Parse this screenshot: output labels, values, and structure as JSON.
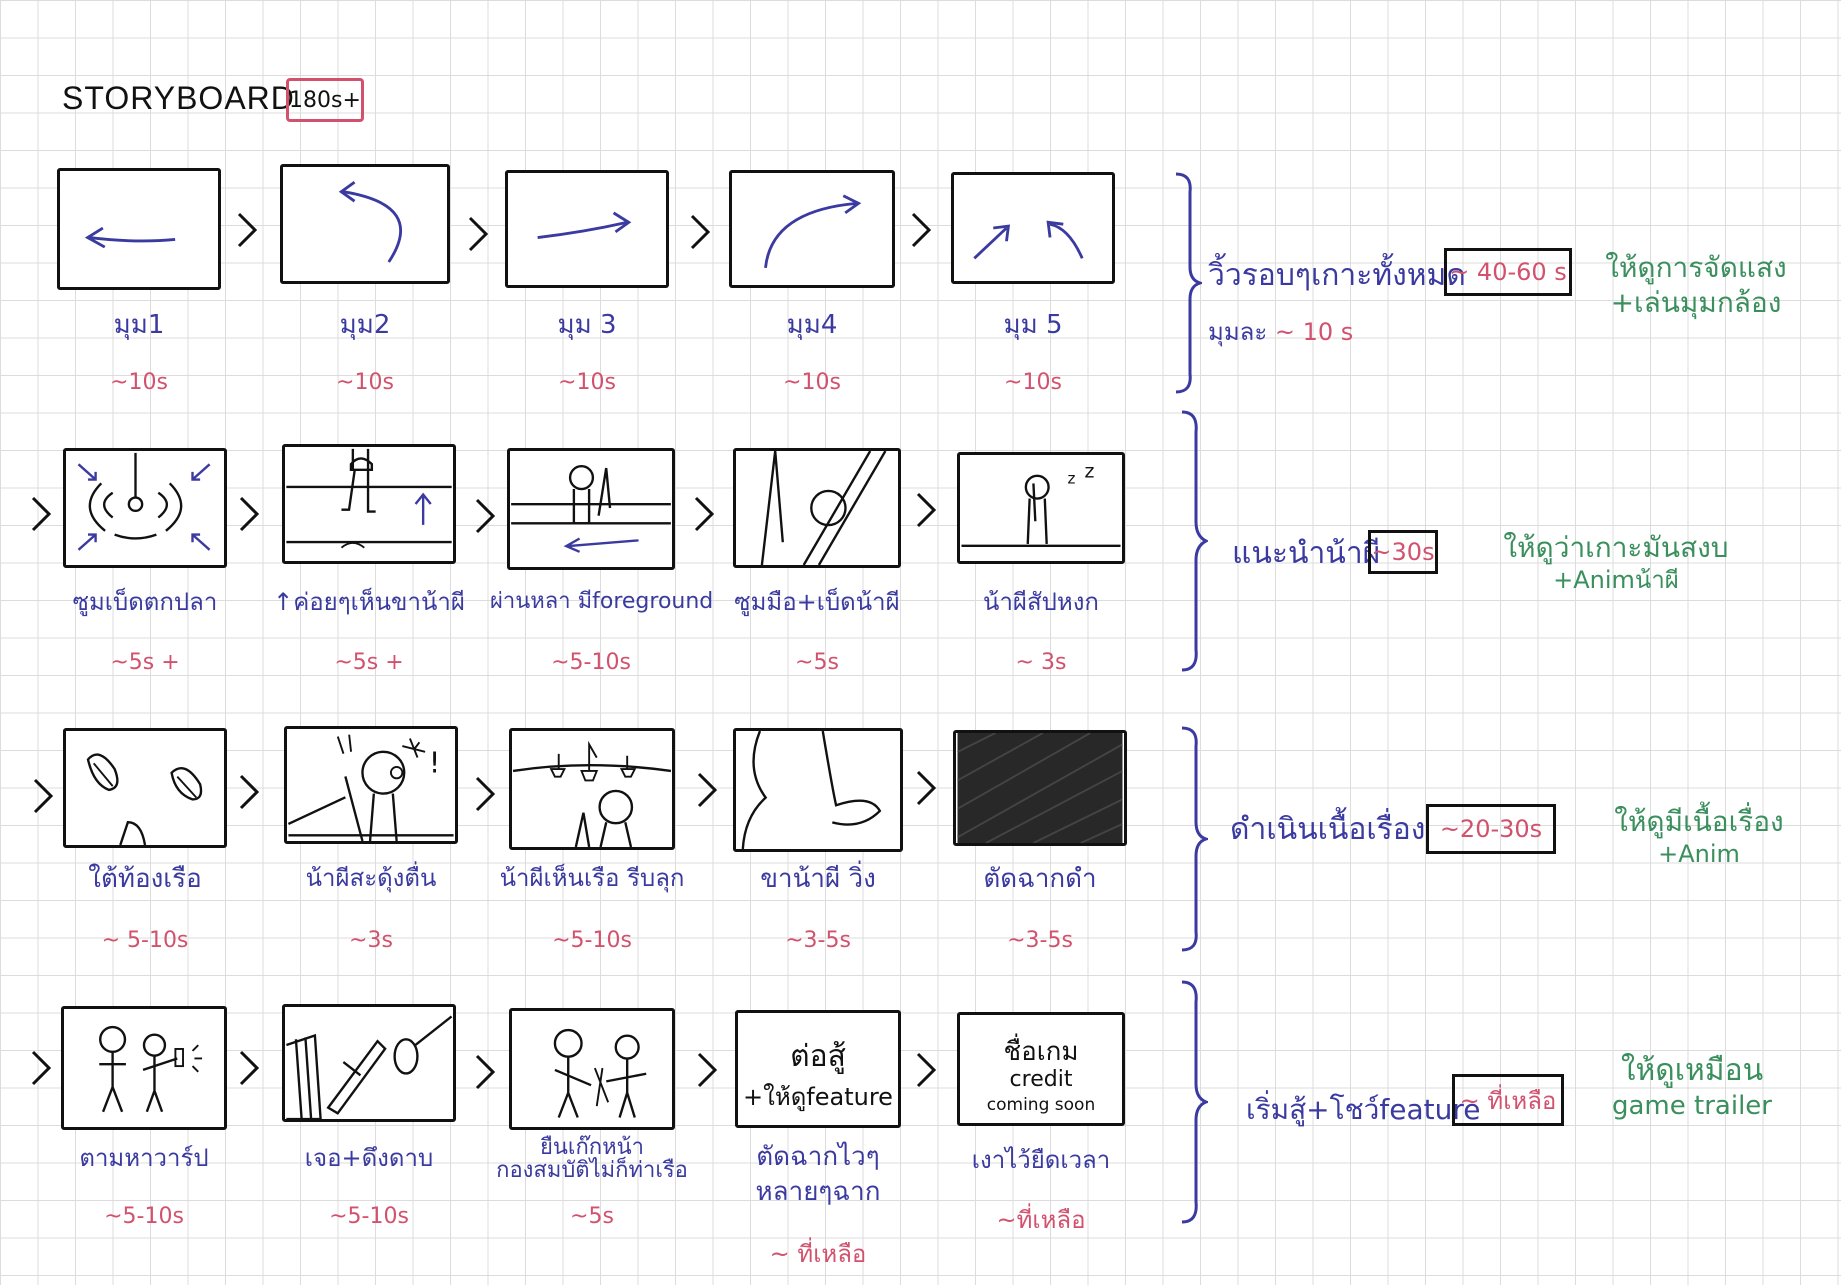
{
  "title": "STORYBOARD",
  "total_badge": "180s+",
  "rows": [
    {
      "shots": [
        {
          "label": "มุม1",
          "duration": "~10s"
        },
        {
          "label": "มุม2",
          "duration": "~10s"
        },
        {
          "label": "มุม 3",
          "duration": "~10s"
        },
        {
          "label": "มุม4",
          "duration": "~10s"
        },
        {
          "label": "มุม 5",
          "duration": "~10s"
        }
      ],
      "section": {
        "text": "วิ้วรอบๆเกาะทั้งหมด",
        "time": "~ 40-60 s",
        "sub_text": "มุมละ",
        "sub_time": "~ 10 s",
        "note_lines": [
          "ให้ดูการจัดแสง",
          "+เล่นมุมกล้อง"
        ]
      }
    },
    {
      "shots": [
        {
          "label": "ซูมเบ็ดตกปลา",
          "duration": "~5s +"
        },
        {
          "label": "↑ค่อยๆเห็นขาน้าผี",
          "duration": "~5s +"
        },
        {
          "label": "ผ่านหลา มีforeground",
          "duration": "~5-10s"
        },
        {
          "label": "ซูมมือ+เบ็ดน้าผี",
          "duration": "~5s"
        },
        {
          "label": "น้าผีสัปหงก",
          "duration": "~ 3s"
        }
      ],
      "section": {
        "text": "แนะนำน้าผี",
        "time": "~30s",
        "note_lines": [
          "ให้ดูว่าเกาะมันสงบ",
          "+Animน้าผี"
        ]
      }
    },
    {
      "shots": [
        {
          "label": "ใต้ท้องเรือ",
          "duration": "~ 5-10s"
        },
        {
          "label": "น้าผีสะดุ้งตื่น",
          "duration": "~3s"
        },
        {
          "label": "น้าผีเห็นเรือ รีบลุก",
          "duration": "~5-10s"
        },
        {
          "label": "ขาน้าผี วิ่ง",
          "duration": "~3-5s"
        },
        {
          "label": "ตัดฉากดำ",
          "duration": "~3-5s"
        }
      ],
      "section": {
        "text": "ดำเนินเนื้อเรื่อง",
        "time": "~20-30s",
        "note_lines": [
          "ให้ดูมีเนื้อเรื่อง",
          "+Anim"
        ]
      }
    },
    {
      "shots": [
        {
          "label": "ตามหาวาร์ป",
          "duration": "~5-10s"
        },
        {
          "label": "เจอ+ดึงดาบ",
          "duration": "~5-10s"
        },
        {
          "label": "ยืนเก๊กหน้า\nกองสมบัติไม่ก็ท่าเรือ",
          "duration": "~5s"
        },
        {
          "label": "ตัดฉากไวๆ\nหลายๆฉาก",
          "duration": "~ ที่เหลือ"
        },
        {
          "label": "เงาไว้ยืดเวลา",
          "duration": "~ที่เหลือ"
        }
      ],
      "frame_text": {
        "shot4_line1": "ต่อสู้",
        "shot4_line2": "+ให้ดูfeature",
        "shot5_line1": "ชื่อเกม",
        "shot5_line2": "credit",
        "shot5_line3": "coming soon"
      },
      "section": {
        "text": "เริ่มสู้+โชว์feature",
        "time": "~ ที่เหลือ",
        "note_lines": [
          "ให้ดูเหมือน",
          "game trailer"
        ]
      }
    }
  ],
  "colors": {
    "ink": "#111111",
    "blue": "#3a3aa0",
    "pink": "#d2526e",
    "green": "#3a8f5d",
    "grid": "#dcdcdc"
  }
}
